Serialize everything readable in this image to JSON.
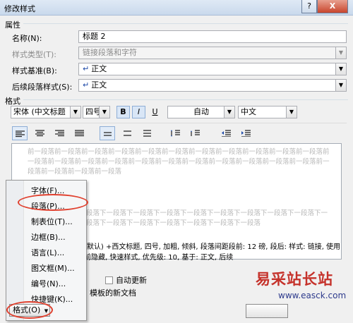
{
  "window": {
    "title": "修改样式",
    "help_label": "?",
    "close_label": "X"
  },
  "properties": {
    "section_label": "属性",
    "name_label": "名称(N):",
    "name_value": "标题 2",
    "type_label": "样式类型(T):",
    "type_value": "链接段落和字符",
    "based_on_label": "样式基准(B):",
    "based_on_value": "正文",
    "next_label": "后续段落样式(S):",
    "next_value": "正文"
  },
  "format": {
    "section_label": "格式",
    "font_value": "宋体 (中文标题",
    "size_value": "四号",
    "bold_label": "B",
    "italic_label": "I",
    "underline_label": "U",
    "color_value": "自动",
    "lang_value": "中文"
  },
  "preview": {
    "prev_text": "前一段落前一段落前一段落前一段落前一段落前一段落前一段落前一段落前一段落前一段落前一段落前一段落前一段落前一段落前一段落前一段落前一段落前一段落前一段落前一段落前一段落前一段落前一段落前一段落前一段落前一段落",
    "next_text": "段落下一段落下一段落下一段落下一段落下一段落下一段落下一段落下一段落下一段落下一段落下一段落下一段落下一段落下一段落下一段落"
  },
  "description": "(默认) +西文标题, 四号, 加粗, 倾斜, 段落间距段前: 12 磅, 段后: 样式: 链接, 使用前隐藏, 快速样式, 优先级: 10, 基于: 正文, 后续",
  "options": {
    "auto_update_label": "自动更新",
    "template_label": "模板的新文档"
  },
  "menu": {
    "items": [
      {
        "label": "字体(F)..."
      },
      {
        "label": "段落(P)..."
      },
      {
        "label": "制表位(T)..."
      },
      {
        "label": "边框(B)..."
      },
      {
        "label": "语言(L)..."
      },
      {
        "label": "图文框(M)..."
      },
      {
        "label": "编号(N)..."
      },
      {
        "label": "快捷键(K)..."
      }
    ]
  },
  "footer": {
    "format_button_label": "格式(O)"
  },
  "watermark": {
    "title": "易采站长站",
    "url": "www.easck.com"
  },
  "colors": {
    "highlight": "#e0402e",
    "watermark_red": "#c5322b",
    "watermark_blue": "#2d3a8c"
  }
}
